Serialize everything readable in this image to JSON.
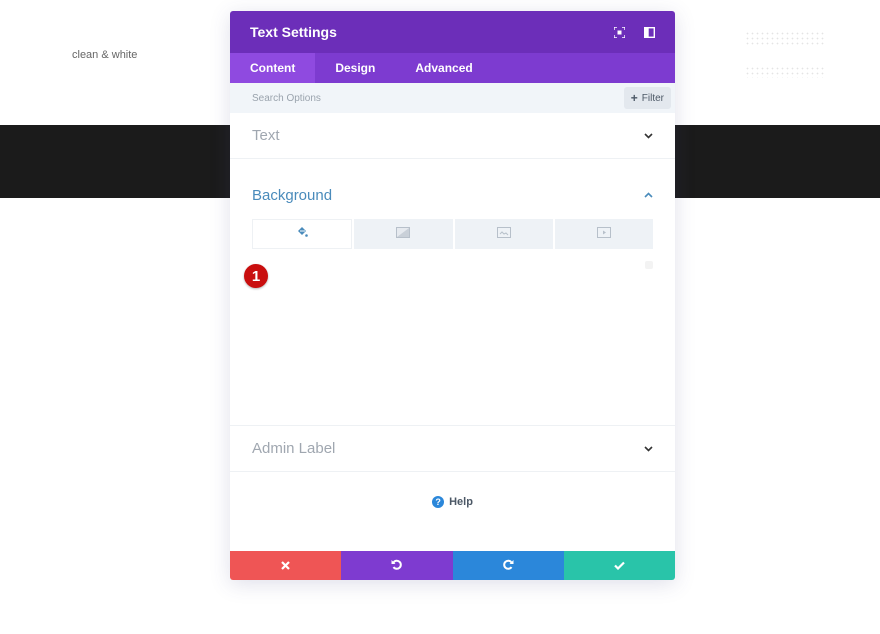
{
  "background_page": {
    "tagline": "clean & white"
  },
  "modal": {
    "title": "Text Settings",
    "header_icons": [
      "expand-icon",
      "split-view-icon"
    ],
    "tabs": [
      {
        "label": "Content",
        "active": true
      },
      {
        "label": "Design",
        "active": false
      },
      {
        "label": "Advanced",
        "active": false
      }
    ],
    "search": {
      "placeholder": "Search Options",
      "value": "",
      "filter_label": "Filter"
    },
    "sections": {
      "text": {
        "title": "Text",
        "expanded": false
      },
      "background": {
        "title": "Background",
        "expanded": true,
        "type_tabs": [
          {
            "icon": "paint-bucket-icon",
            "label": "Color",
            "active": true
          },
          {
            "icon": "gradient-icon",
            "label": "Gradient",
            "active": false
          },
          {
            "icon": "image-icon",
            "label": "Image",
            "active": false
          },
          {
            "icon": "video-icon",
            "label": "Video",
            "active": false
          }
        ],
        "step_badge": "1"
      },
      "admin_label": {
        "title": "Admin Label",
        "expanded": false
      }
    },
    "help_label": "Help",
    "footer": {
      "buttons": [
        {
          "name": "cancel",
          "icon": "close-icon",
          "color": "#ef5555"
        },
        {
          "name": "undo",
          "icon": "undo-icon",
          "color": "#7e3bd0"
        },
        {
          "name": "redo",
          "icon": "redo-icon",
          "color": "#2b87da"
        },
        {
          "name": "save",
          "icon": "check-icon",
          "color": "#29c4a9"
        }
      ]
    }
  },
  "colors": {
    "header_purple": "#6c2eb9",
    "tabs_purple": "#7d3bd0",
    "active_tab_purple": "#8f4ae0",
    "section_active_blue": "#4a8bbb",
    "badge_red": "#c90e0e",
    "dark_band": "#1b1b1b"
  }
}
